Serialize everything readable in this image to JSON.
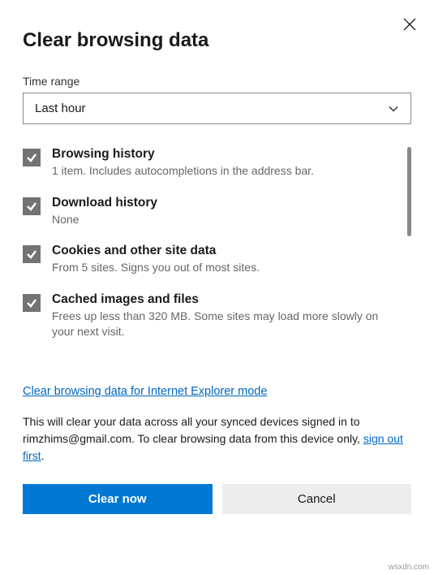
{
  "dialog": {
    "title": "Clear browsing data",
    "time_range_label": "Time range",
    "time_range_value": "Last hour"
  },
  "options": [
    {
      "title": "Browsing history",
      "desc": "1 item. Includes autocompletions in the address bar."
    },
    {
      "title": "Download history",
      "desc": "None"
    },
    {
      "title": "Cookies and other site data",
      "desc": "From 5 sites. Signs you out of most sites."
    },
    {
      "title": "Cached images and files",
      "desc": "Frees up less than 320 MB. Some sites may load more slowly on your next visit."
    }
  ],
  "ie_link": "Clear browsing data for Internet Explorer mode",
  "info": {
    "prefix": "This will clear your data across all your synced devices signed in to rimzhims@gmail.com. To clear browsing data from this device only, ",
    "link": "sign out first",
    "suffix": "."
  },
  "buttons": {
    "clear": "Clear now",
    "cancel": "Cancel"
  },
  "watermark": "wsxdn.com"
}
